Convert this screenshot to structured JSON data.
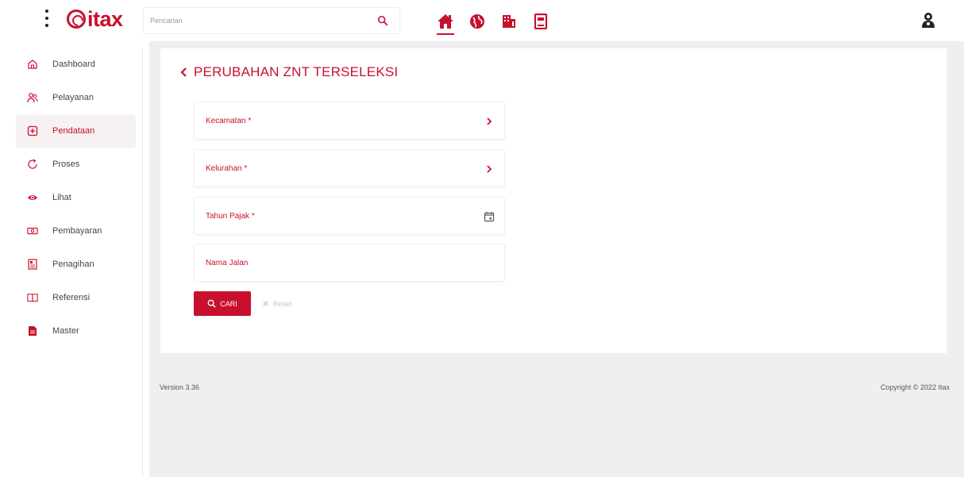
{
  "header": {
    "logo_text": "itax",
    "search_placeholder": "Pencarian",
    "nav": [
      {
        "icon": "home-icon",
        "active": true
      },
      {
        "icon": "globe-icon",
        "active": false
      },
      {
        "icon": "building-icon",
        "active": false
      },
      {
        "icon": "book-icon",
        "active": false
      }
    ],
    "user_icon": "user-icon"
  },
  "sidebar": {
    "items": [
      {
        "label": "Dashboard",
        "icon": "home-outline-icon"
      },
      {
        "label": "Pelayanan",
        "icon": "users-icon"
      },
      {
        "label": "Pendataan",
        "icon": "plus-square-icon",
        "active": true
      },
      {
        "label": "Proses",
        "icon": "refresh-icon"
      },
      {
        "label": "Lihat",
        "icon": "eye-icon"
      },
      {
        "label": "Pembayaran",
        "icon": "money-icon"
      },
      {
        "label": "Penagihan",
        "icon": "invoice-icon"
      },
      {
        "label": "Referensi",
        "icon": "book-open-icon"
      },
      {
        "label": "Master",
        "icon": "file-icon"
      }
    ]
  },
  "main": {
    "title": "PERUBAHAN ZNT TERSELEKSI",
    "fields": [
      {
        "label": "Kecamatan *",
        "icon": "chevron-right-icon"
      },
      {
        "label": "Kelurahan *",
        "icon": "chevron-right-icon"
      },
      {
        "label": "Tahun Pajak *",
        "icon": "calendar-icon"
      },
      {
        "label": "Nama Jalan",
        "icon": ""
      }
    ],
    "search_button": "CARI",
    "reset_button": "Reset"
  },
  "footer": {
    "version": "Version 3.36",
    "copyright": "Copyright © 2022 Itax"
  },
  "colors": {
    "accent": "#c8102e",
    "background": "#efefef",
    "sidebar_active_bg": "#f6f1f2"
  }
}
